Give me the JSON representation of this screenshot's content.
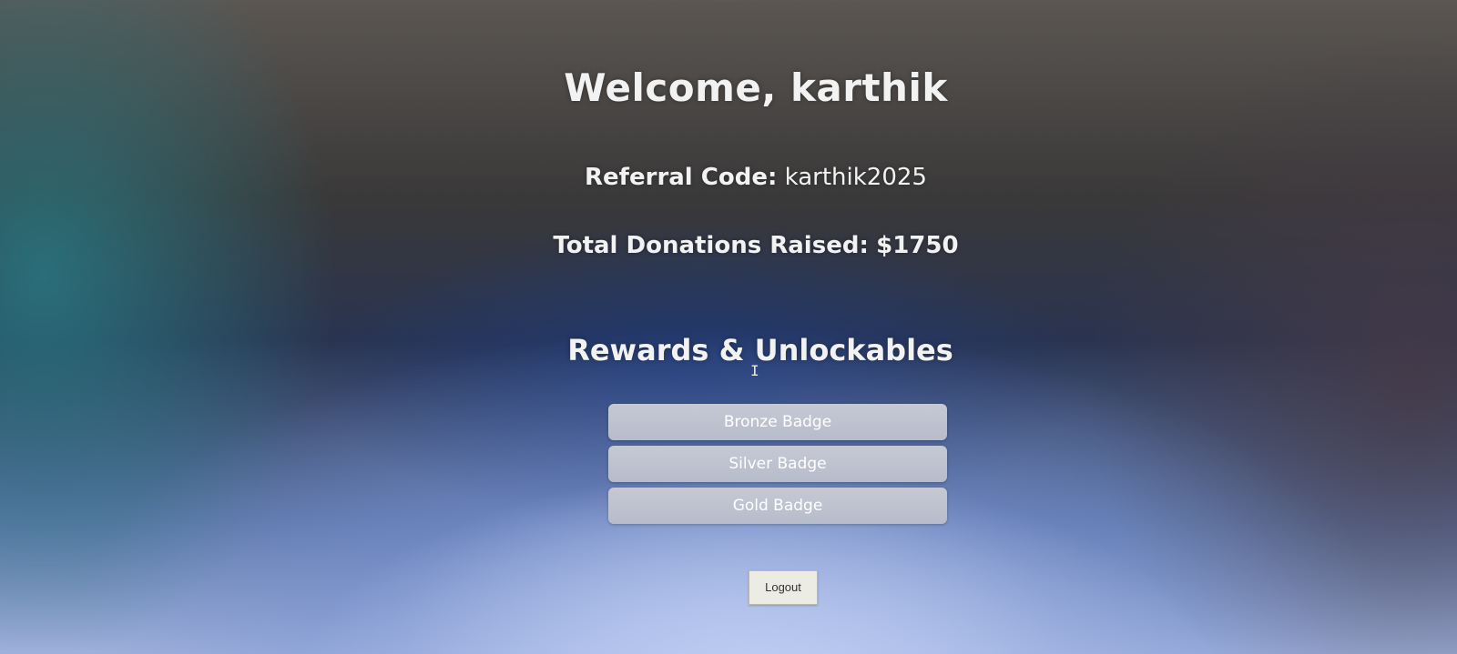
{
  "header": {
    "welcome": "Welcome, karthik"
  },
  "profile": {
    "referral_label": "Referral Code:",
    "referral_value": "karthik2025",
    "donations_label": "Total Donations Raised:",
    "donations_value": "$1750"
  },
  "rewards": {
    "title": "Rewards & Unlockables",
    "items": [
      {
        "label": "Bronze Badge"
      },
      {
        "label": "Silver Badge"
      },
      {
        "label": "Gold Badge"
      }
    ]
  },
  "actions": {
    "logout_label": "Logout"
  },
  "colors": {
    "badge_background": "#bfc3cf",
    "logout_background": "#ecece4"
  }
}
